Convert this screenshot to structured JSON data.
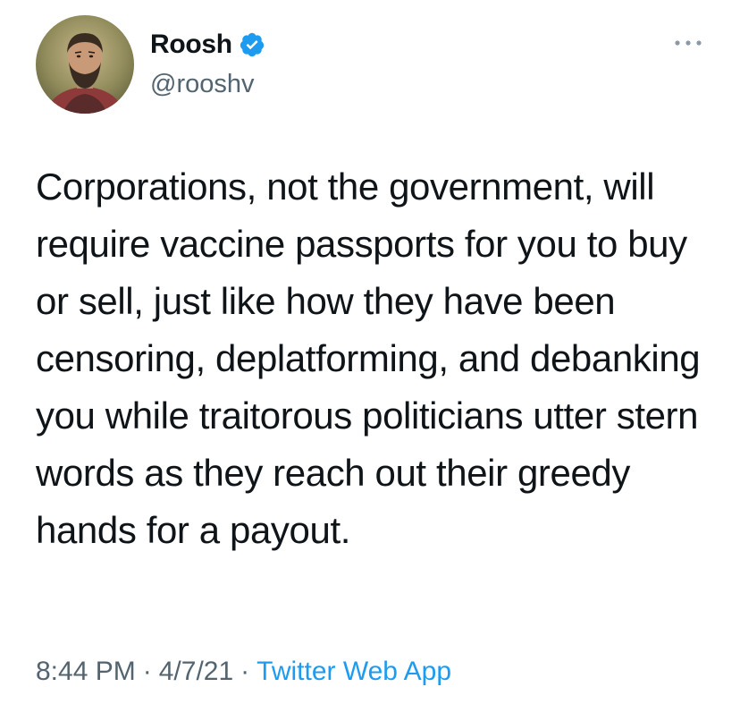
{
  "author": {
    "display_name": "Roosh",
    "handle": "@rooshv",
    "verified": true,
    "avatar_icon": "profile-photo"
  },
  "tweet": {
    "text": "Corporations, not the government, will require vaccine passports for you to buy or sell, just like how they have been censoring, deplatforming, and debanking you while traitorous politicians utter stern words as they reach out their greedy hands for a payout.",
    "time": "8:44 PM",
    "date": "4/7/21",
    "source": "Twitter Web App",
    "separator": "·"
  },
  "colors": {
    "text": "#0f1419",
    "secondary": "#536471",
    "link": "#1d9bf0",
    "verified_badge": "#1d9bf0"
  },
  "icons": {
    "more": "more-options-icon",
    "verified": "verified-badge-icon"
  }
}
